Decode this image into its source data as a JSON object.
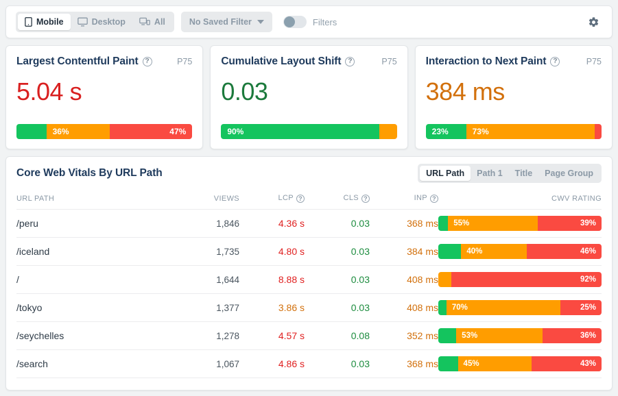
{
  "toolbar": {
    "devices": [
      {
        "label": "Mobile",
        "icon": "mobile-icon",
        "active": true
      },
      {
        "label": "Desktop",
        "icon": "desktop-icon",
        "active": false
      },
      {
        "label": "All",
        "icon": "all-devices-icon",
        "active": false
      }
    ],
    "saved_filter": "No Saved Filter",
    "filters_label": "Filters",
    "filters_enabled": false,
    "settings_icon": "gear-icon"
  },
  "metrics": [
    {
      "title": "Largest Contentful Paint",
      "help_icon": "question-mark-icon",
      "percentile": "P75",
      "value": "5.04 s",
      "value_color": "#d92020",
      "bar": [
        {
          "rating": "good",
          "pct": 17,
          "label": ""
        },
        {
          "rating": "needs-improvement",
          "pct": 36,
          "label": "36%",
          "align": "left"
        },
        {
          "rating": "poor",
          "pct": 47,
          "label": "47%",
          "align": "right"
        }
      ]
    },
    {
      "title": "Cumulative Layout Shift",
      "help_icon": "question-mark-icon",
      "percentile": "P75",
      "value": "0.03",
      "value_color": "#1c7a3c",
      "bar": [
        {
          "rating": "good",
          "pct": 90,
          "label": "90%",
          "align": "left"
        },
        {
          "rating": "needs-improvement",
          "pct": 10,
          "label": ""
        }
      ]
    },
    {
      "title": "Interaction to Next Paint",
      "help_icon": "question-mark-icon",
      "percentile": "P75",
      "value": "384 ms",
      "value_color": "#d2700c",
      "bar": [
        {
          "rating": "good",
          "pct": 23,
          "label": "23%",
          "align": "left"
        },
        {
          "rating": "needs-improvement",
          "pct": 73,
          "label": "73%",
          "align": "left"
        },
        {
          "rating": "poor",
          "pct": 4,
          "label": ""
        }
      ]
    }
  ],
  "table": {
    "title": "Core Web Vitals By URL Path",
    "view_options": [
      {
        "label": "URL Path",
        "active": true
      },
      {
        "label": "Path 1",
        "active": false
      },
      {
        "label": "Title",
        "active": false
      },
      {
        "label": "Page Group",
        "active": false
      }
    ],
    "columns": {
      "path": "URL PATH",
      "views": "VIEWS",
      "lcp": "LCP",
      "cls": "CLS",
      "inp": "INP",
      "rating": "CWV RATING"
    },
    "rows": [
      {
        "path": "/peru",
        "views": "1,846",
        "lcp": "4.36 s",
        "lcp_rating": "poor",
        "cls": "0.03",
        "cls_rating": "good",
        "inp": "368 ms",
        "inp_rating": "needs-improvement",
        "bar": [
          {
            "rating": "good",
            "pct": 6,
            "label": ""
          },
          {
            "rating": "needs-improvement",
            "pct": 55,
            "label": "55%",
            "align": "left"
          },
          {
            "rating": "poor",
            "pct": 39,
            "label": "39%",
            "align": "right"
          }
        ]
      },
      {
        "path": "/iceland",
        "views": "1,735",
        "lcp": "4.80 s",
        "lcp_rating": "poor",
        "cls": "0.03",
        "cls_rating": "good",
        "inp": "384 ms",
        "inp_rating": "needs-improvement",
        "bar": [
          {
            "rating": "good",
            "pct": 14,
            "label": ""
          },
          {
            "rating": "needs-improvement",
            "pct": 40,
            "label": "40%",
            "align": "left"
          },
          {
            "rating": "poor",
            "pct": 46,
            "label": "46%",
            "align": "right"
          }
        ]
      },
      {
        "path": "/",
        "views": "1,644",
        "lcp": "8.88 s",
        "lcp_rating": "poor",
        "cls": "0.03",
        "cls_rating": "good",
        "inp": "408 ms",
        "inp_rating": "needs-improvement",
        "bar": [
          {
            "rating": "needs-improvement",
            "pct": 8,
            "label": ""
          },
          {
            "rating": "poor",
            "pct": 92,
            "label": "92%",
            "align": "right"
          }
        ]
      },
      {
        "path": "/tokyo",
        "views": "1,377",
        "lcp": "3.86 s",
        "lcp_rating": "needs-improvement",
        "cls": "0.03",
        "cls_rating": "good",
        "inp": "408 ms",
        "inp_rating": "needs-improvement",
        "bar": [
          {
            "rating": "good",
            "pct": 5,
            "label": ""
          },
          {
            "rating": "needs-improvement",
            "pct": 70,
            "label": "70%",
            "align": "left"
          },
          {
            "rating": "poor",
            "pct": 25,
            "label": "25%",
            "align": "right"
          }
        ]
      },
      {
        "path": "/seychelles",
        "views": "1,278",
        "lcp": "4.57 s",
        "lcp_rating": "poor",
        "cls": "0.08",
        "cls_rating": "good",
        "inp": "352 ms",
        "inp_rating": "needs-improvement",
        "bar": [
          {
            "rating": "good",
            "pct": 11,
            "label": ""
          },
          {
            "rating": "needs-improvement",
            "pct": 53,
            "label": "53%",
            "align": "left"
          },
          {
            "rating": "poor",
            "pct": 36,
            "label": "36%",
            "align": "right"
          }
        ]
      },
      {
        "path": "/search",
        "views": "1,067",
        "lcp": "4.86 s",
        "lcp_rating": "poor",
        "cls": "0.03",
        "cls_rating": "good",
        "inp": "368 ms",
        "inp_rating": "needs-improvement",
        "bar": [
          {
            "rating": "good",
            "pct": 12,
            "label": ""
          },
          {
            "rating": "needs-improvement",
            "pct": 45,
            "label": "45%",
            "align": "left"
          },
          {
            "rating": "poor",
            "pct": 43,
            "label": "43%",
            "align": "right"
          }
        ]
      }
    ]
  },
  "colors": {
    "good": "#14c45e",
    "needs_improvement": "#ff9d00",
    "poor": "#fa4a41",
    "title": "#1e3a5c",
    "muted": "#8b99a6"
  }
}
